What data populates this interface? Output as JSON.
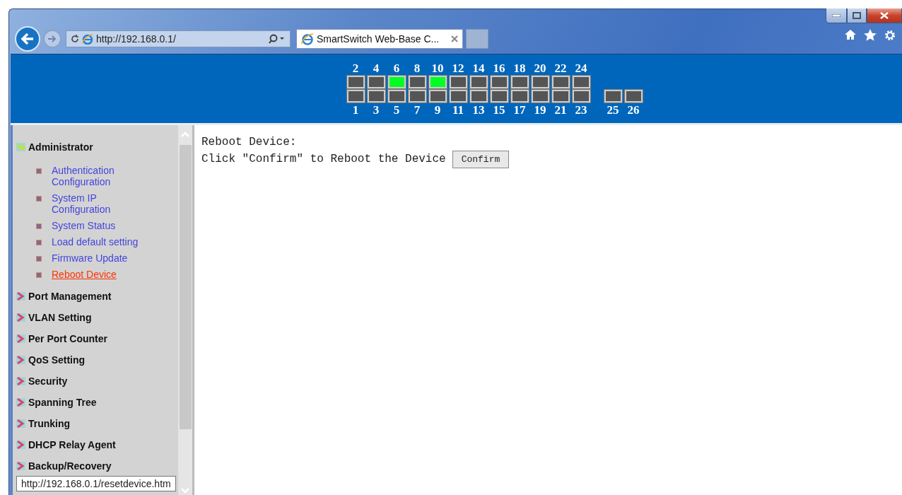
{
  "browser": {
    "address": "http://192.168.0.1/",
    "tabs": [
      {
        "title": "SmartSwitch Web-Base C...",
        "selected": true
      }
    ]
  },
  "port_panel": {
    "top_row": [
      {
        "label": "2",
        "link": false
      },
      {
        "label": "4",
        "link": false
      },
      {
        "label": "6",
        "link": true
      },
      {
        "label": "8",
        "link": false
      },
      {
        "label": "10",
        "link": true
      },
      {
        "label": "12",
        "link": false
      },
      {
        "label": "14",
        "link": false
      },
      {
        "label": "16",
        "link": false
      },
      {
        "label": "18",
        "link": false
      },
      {
        "label": "20",
        "link": false
      },
      {
        "label": "22",
        "link": false
      },
      {
        "label": "24",
        "link": false
      }
    ],
    "bottom_row": [
      {
        "label": "1",
        "link": false
      },
      {
        "label": "3",
        "link": false
      },
      {
        "label": "5",
        "link": false
      },
      {
        "label": "7",
        "link": false
      },
      {
        "label": "9",
        "link": false
      },
      {
        "label": "11",
        "link": false
      },
      {
        "label": "13",
        "link": false
      },
      {
        "label": "15",
        "link": false
      },
      {
        "label": "17",
        "link": false
      },
      {
        "label": "19",
        "link": false
      },
      {
        "label": "21",
        "link": false
      },
      {
        "label": "23",
        "link": false
      }
    ],
    "uplinks": [
      {
        "label": "25",
        "link": false
      },
      {
        "label": "26",
        "link": false
      }
    ]
  },
  "sidebar": {
    "groups": [
      {
        "label": "Administrator",
        "expanded": true,
        "children": [
          {
            "label": "Authentication Configuration",
            "selected": false
          },
          {
            "label": "System IP Configuration",
            "selected": false
          },
          {
            "label": "System Status",
            "selected": false
          },
          {
            "label": "Load default setting",
            "selected": false
          },
          {
            "label": "Firmware Update",
            "selected": false
          },
          {
            "label": "Reboot Device",
            "selected": true
          }
        ]
      },
      {
        "label": "Port Management",
        "expanded": false
      },
      {
        "label": "VLAN Setting",
        "expanded": false
      },
      {
        "label": "Per Port Counter",
        "expanded": false
      },
      {
        "label": "QoS Setting",
        "expanded": false
      },
      {
        "label": "Security",
        "expanded": false
      },
      {
        "label": "Spanning Tree",
        "expanded": false
      },
      {
        "label": "Trunking",
        "expanded": false
      },
      {
        "label": "DHCP Relay Agent",
        "expanded": false
      },
      {
        "label": "Backup/Recovery",
        "expanded": false
      }
    ]
  },
  "content": {
    "heading": "Reboot Device:",
    "instruction": "Click \"Confirm\" to Reboot the Device",
    "button": "Confirm"
  },
  "status_bar": {
    "url": "http://192.168.0.1/resetdevice.htm"
  }
}
